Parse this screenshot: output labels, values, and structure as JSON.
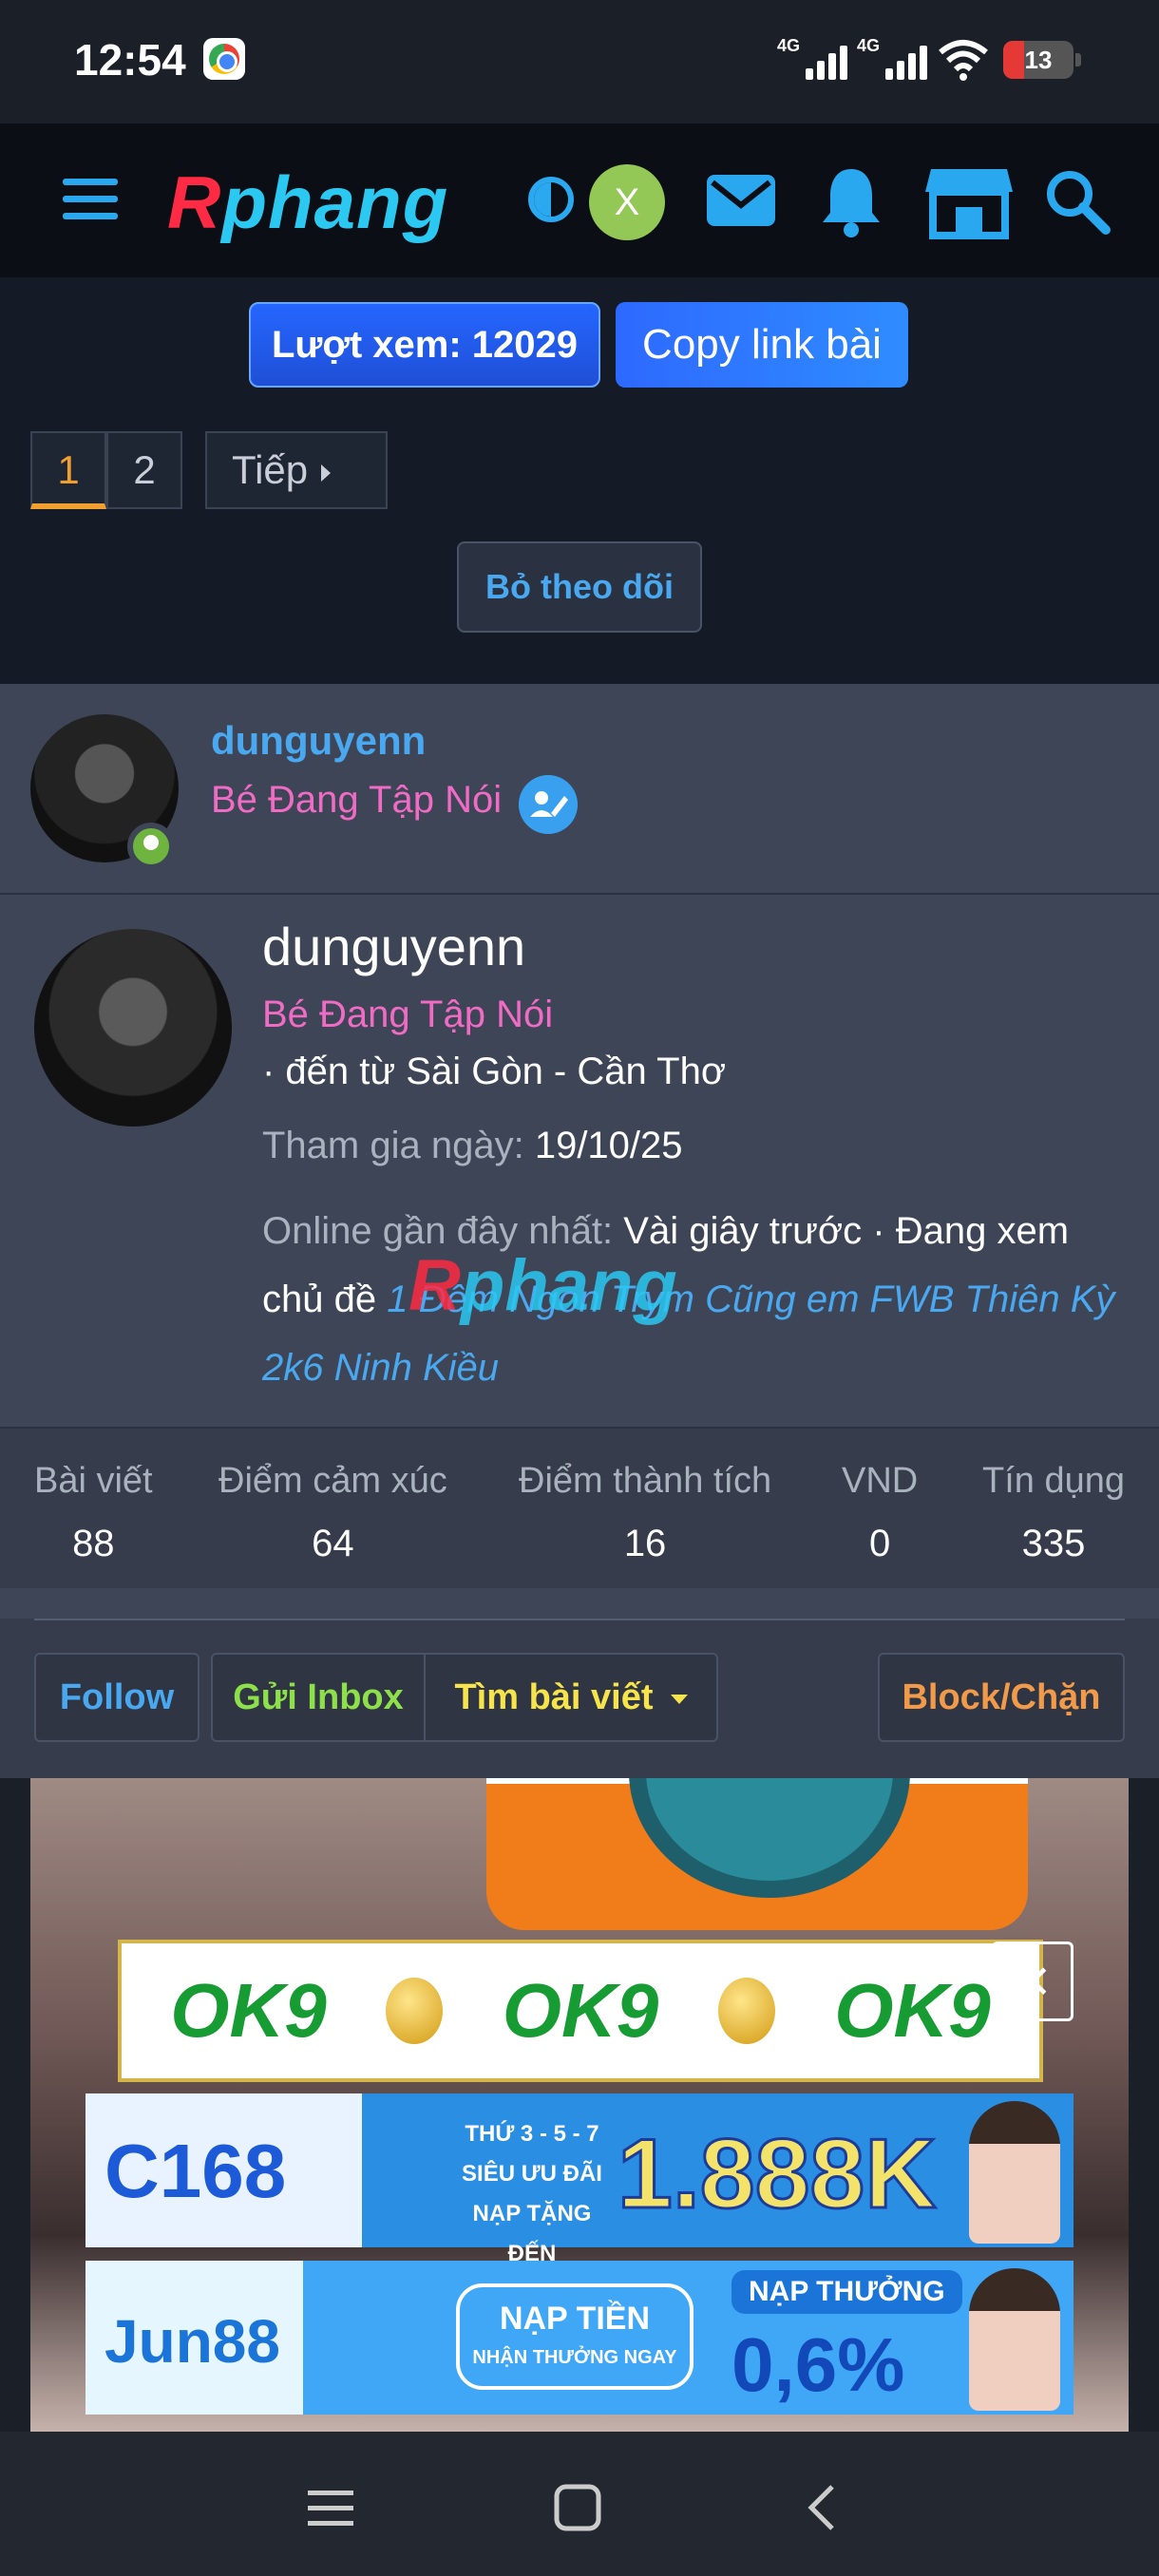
{
  "status_bar": {
    "time": "12:54",
    "signal1_label": "4G",
    "signal2_label": "4G",
    "battery": "13"
  },
  "header": {
    "logo_first": "R",
    "logo_rest": "phang",
    "avatar_letter": "X"
  },
  "thread": {
    "views_label": "Lượt xem: 12029",
    "copy_link_label": "Copy link bài",
    "pages": [
      "1",
      "2"
    ],
    "next_label": "Tiếp",
    "unfollow_label": "Bỏ theo dõi"
  },
  "post_author": {
    "username": "dunguyenn",
    "title": "Bé Đang Tập Nói"
  },
  "member_card": {
    "username": "dunguyenn",
    "title": "Bé Đang Tập Nói",
    "location": "· đến từ Sài Gòn - Cần Thơ",
    "joined_label": "Tham gia ngày:",
    "joined_value": "19/10/25",
    "online_label": "Online gần đây nhất:",
    "online_value": "Vài giây trước · Đang xem chủ đề",
    "viewing_thread": "1 Đêm Ngon Trym Cũng em FWB Thiên Kỳ 2k6 Ninh Kiều",
    "stats": [
      {
        "label": "Bài viết",
        "value": "88"
      },
      {
        "label": "Điểm cảm xúc",
        "value": "64"
      },
      {
        "label": "Điểm thành tích",
        "value": "16"
      },
      {
        "label": "VND",
        "value": "0"
      },
      {
        "label": "Tín dụng",
        "value": "335"
      }
    ],
    "buttons": {
      "follow": "Follow",
      "inbox": "Gửi Inbox",
      "find_posts": "Tìm bài viết",
      "block": "Block/Chặn"
    },
    "colors": {
      "follow": "#49a8ef",
      "inbox": "#8ee04a",
      "find_posts": "#f7e34a",
      "block": "#f19a4a"
    }
  },
  "ads": {
    "ok9": "OK9",
    "c168_logo": "C168",
    "c168_small": "THỨ 3 - 5 - 7 SIÊU ƯU ĐÃI NẠP TẶNG ĐẾN",
    "c168_big": "1.888K",
    "jun_logo": "Jun88",
    "jun_pill_a": "NẠP TIỀN",
    "jun_pill_b": "NHẬN THƯỞNG NGAY",
    "jun_top": "NẠP THƯỞNG",
    "jun_big": "0,6%",
    "close": "×"
  }
}
